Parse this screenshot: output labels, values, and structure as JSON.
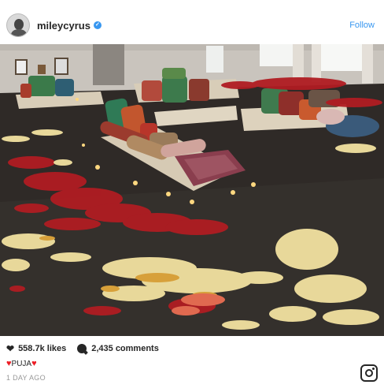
{
  "post": {
    "username": "mileycyrus",
    "follow_label": "Follow",
    "likes": "558.7k likes",
    "comments": "2,435 comments",
    "caption": "PUJA",
    "timestamp": "1 DAY AGO"
  },
  "icons": {
    "verified": "verified-badge-icon",
    "like": "heart-icon",
    "comment": "comment-icon",
    "brand": "instagram-icon"
  },
  "colors": {
    "link": "#3897f0",
    "caption_heart": "#ed1c24"
  }
}
